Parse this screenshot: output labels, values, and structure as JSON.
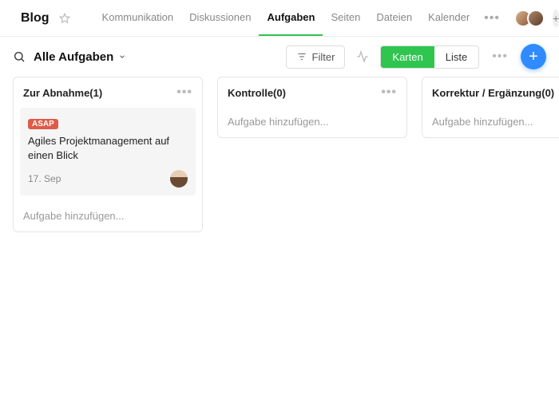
{
  "page": {
    "title": "Blog"
  },
  "nav": {
    "items": [
      {
        "label": "Kommunikation"
      },
      {
        "label": "Diskussionen"
      },
      {
        "label": "Aufgaben"
      },
      {
        "label": "Seiten"
      },
      {
        "label": "Dateien"
      },
      {
        "label": "Kalender"
      }
    ]
  },
  "toolbar": {
    "view_title": "Alle Aufgaben",
    "filter_label": "Filter",
    "toggle": {
      "cards": "Karten",
      "list": "Liste"
    }
  },
  "columns": [
    {
      "title": "Zur Abnahme(1)",
      "add_placeholder": "Aufgabe hinzufügen...",
      "card": {
        "badge": "ASAP",
        "title": "Agiles Projektmanagement auf einen Blick",
        "date": "17. Sep"
      }
    },
    {
      "title": "Kontrolle(0)",
      "add_placeholder": "Aufgabe hinzufügen..."
    },
    {
      "title": "Korrektur / Ergänzung(0)",
      "add_placeholder": "Aufgabe hinzufügen..."
    }
  ]
}
